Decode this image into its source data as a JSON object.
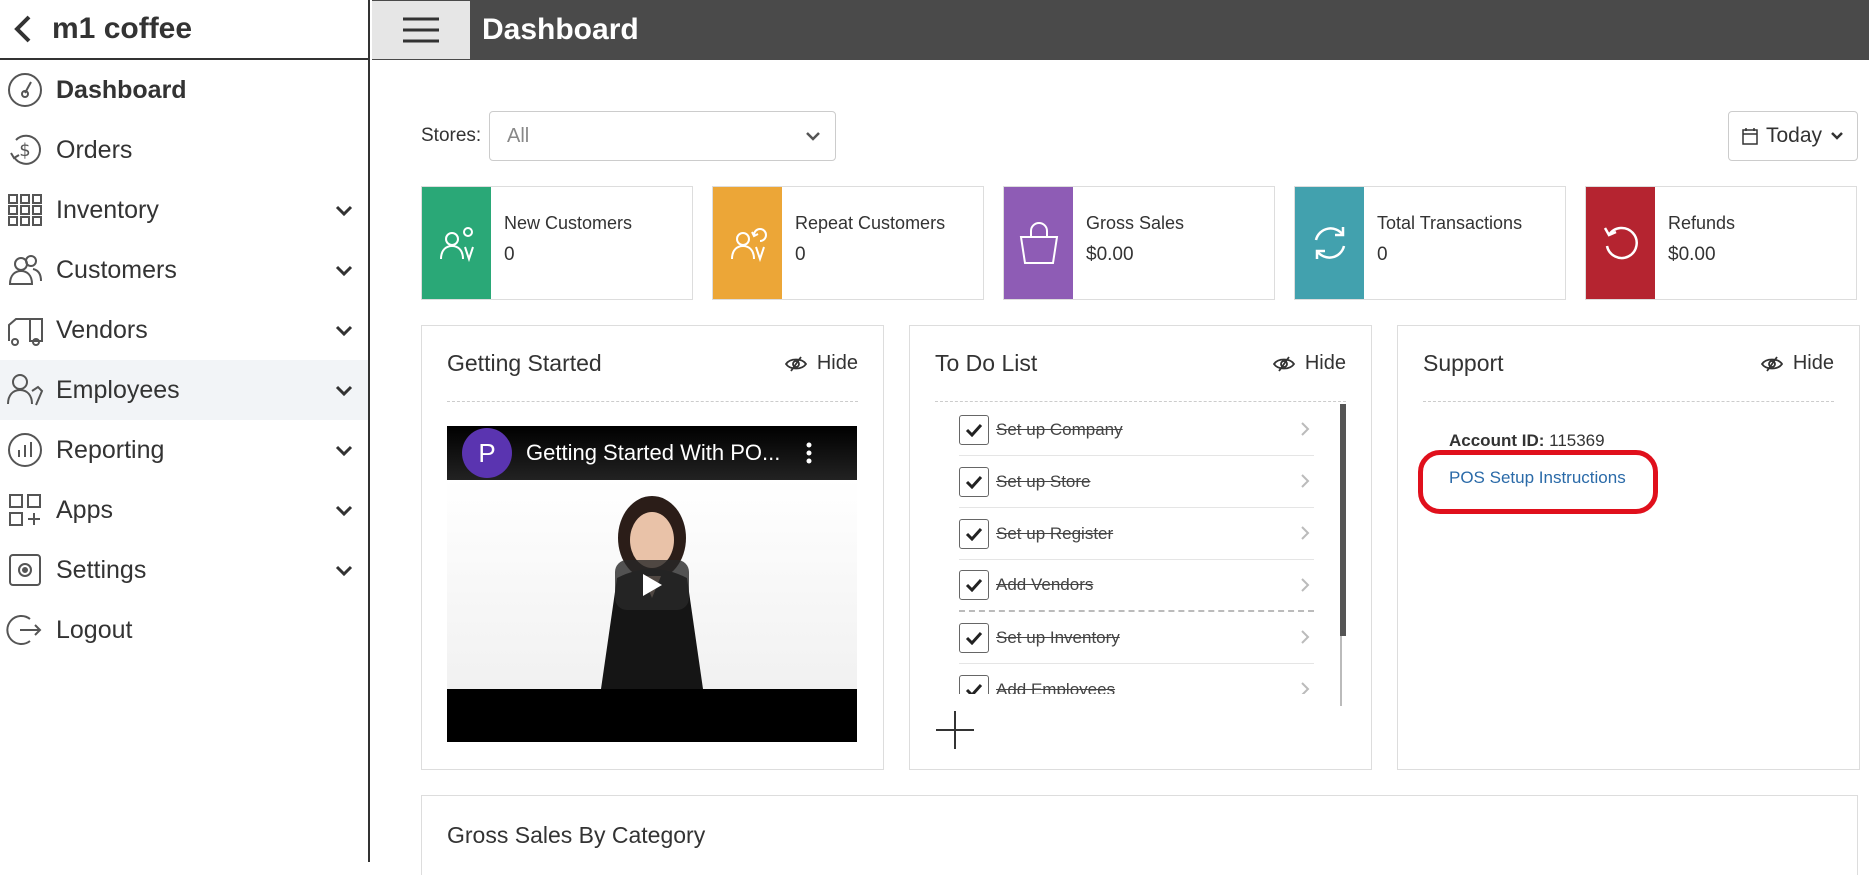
{
  "sidebar": {
    "title": "m1 coffee",
    "items": [
      {
        "label": "Dashboard",
        "icon": "speedometer-icon",
        "has_chevron": false
      },
      {
        "label": "Orders",
        "icon": "dollar-refresh-icon",
        "has_chevron": false
      },
      {
        "label": "Inventory",
        "icon": "grid-icon",
        "has_chevron": true
      },
      {
        "label": "Customers",
        "icon": "users-icon",
        "has_chevron": true
      },
      {
        "label": "Vendors",
        "icon": "truck-icon",
        "has_chevron": true
      },
      {
        "label": "Employees",
        "icon": "employee-icon",
        "has_chevron": true
      },
      {
        "label": "Reporting",
        "icon": "bar-chart-icon",
        "has_chevron": true
      },
      {
        "label": "Apps",
        "icon": "apps-icon",
        "has_chevron": true
      },
      {
        "label": "Settings",
        "icon": "gear-icon",
        "has_chevron": true
      },
      {
        "label": "Logout",
        "icon": "logout-icon",
        "has_chevron": false
      }
    ]
  },
  "topbar": {
    "title": "Dashboard"
  },
  "filters": {
    "stores_label": "Stores:",
    "stores_value": "All",
    "date_range": "Today"
  },
  "stats": [
    {
      "label": "New Customers",
      "value": "0",
      "color": "#2aa877",
      "icon": "new-customer-icon"
    },
    {
      "label": "Repeat Customers",
      "value": "0",
      "color": "#eca637",
      "icon": "repeat-customer-icon"
    },
    {
      "label": "Gross Sales",
      "value": "$0.00",
      "color": "#8e5cb5",
      "icon": "shopping-bag-icon"
    },
    {
      "label": "Total Transactions",
      "value": "0",
      "color": "#42a1ae",
      "icon": "sync-icon"
    },
    {
      "label": "Refunds",
      "value": "$0.00",
      "color": "#b52430",
      "icon": "undo-icon"
    }
  ],
  "getting_started": {
    "title": "Getting Started",
    "hide_label": "Hide",
    "video_title": "Getting Started With PO...",
    "channel_initial": "P"
  },
  "todo": {
    "title": "To Do List",
    "hide_label": "Hide",
    "items": [
      {
        "label": "Set up Company",
        "done": true
      },
      {
        "label": "Set up Store",
        "done": true
      },
      {
        "label": "Set up Register",
        "done": true
      },
      {
        "label": "Add Vendors",
        "done": true
      },
      {
        "label": "Set up Inventory",
        "done": true
      },
      {
        "label": "Add Employees",
        "done": true
      }
    ]
  },
  "support": {
    "title": "Support",
    "hide_label": "Hide",
    "account_id_label": "Account ID:",
    "account_id": "115369",
    "pos_link": "POS Setup Instructions"
  },
  "gross_sales": {
    "title": "Gross Sales By Category"
  }
}
